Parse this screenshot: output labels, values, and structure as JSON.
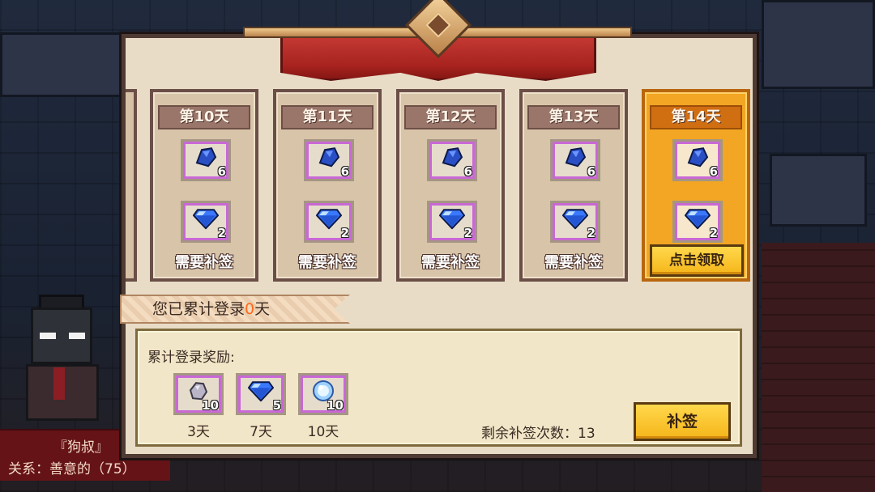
{
  "npc": {
    "name": "『狗叔』",
    "relation": "关系：善意的（75）"
  },
  "day_cards": [
    {
      "day_label": "第10天",
      "rewards": [
        {
          "icon": "blue-ore-icon",
          "qty": "6"
        },
        {
          "icon": "blue-gem-icon",
          "qty": "2"
        }
      ],
      "status": "需要补签",
      "claimable": false
    },
    {
      "day_label": "第11天",
      "rewards": [
        {
          "icon": "blue-ore-icon",
          "qty": "6"
        },
        {
          "icon": "blue-gem-icon",
          "qty": "2"
        }
      ],
      "status": "需要补签",
      "claimable": false
    },
    {
      "day_label": "第12天",
      "rewards": [
        {
          "icon": "blue-ore-icon",
          "qty": "6"
        },
        {
          "icon": "blue-gem-icon",
          "qty": "2"
        }
      ],
      "status": "需要补签",
      "claimable": false
    },
    {
      "day_label": "第13天",
      "rewards": [
        {
          "icon": "blue-ore-icon",
          "qty": "6"
        },
        {
          "icon": "blue-gem-icon",
          "qty": "2"
        }
      ],
      "status": "需要补签",
      "claimable": false
    },
    {
      "day_label": "第14天",
      "rewards": [
        {
          "icon": "blue-ore-icon",
          "qty": "6"
        },
        {
          "icon": "blue-gem-icon",
          "qty": "2"
        }
      ],
      "status": "点击领取",
      "claimable": true
    }
  ],
  "login_banner": {
    "prefix": "您已累计登录",
    "count": "0",
    "suffix": "天"
  },
  "cumulative": {
    "title": "累计登录奖励:",
    "rewards": [
      {
        "icon": "stone-icon",
        "qty": "10",
        "days": "3天"
      },
      {
        "icon": "blue-gem-icon",
        "qty": "5",
        "days": "7天"
      },
      {
        "icon": "blue-orb-icon",
        "qty": "10",
        "days": "10天"
      }
    ],
    "remaining_label": "剩余补签次数：13",
    "makeup_button": "补签"
  },
  "colors": {
    "accent_orange": "#f2a623",
    "count_highlight": "#ff6a1a",
    "ribbon_red": "#a8231f"
  }
}
